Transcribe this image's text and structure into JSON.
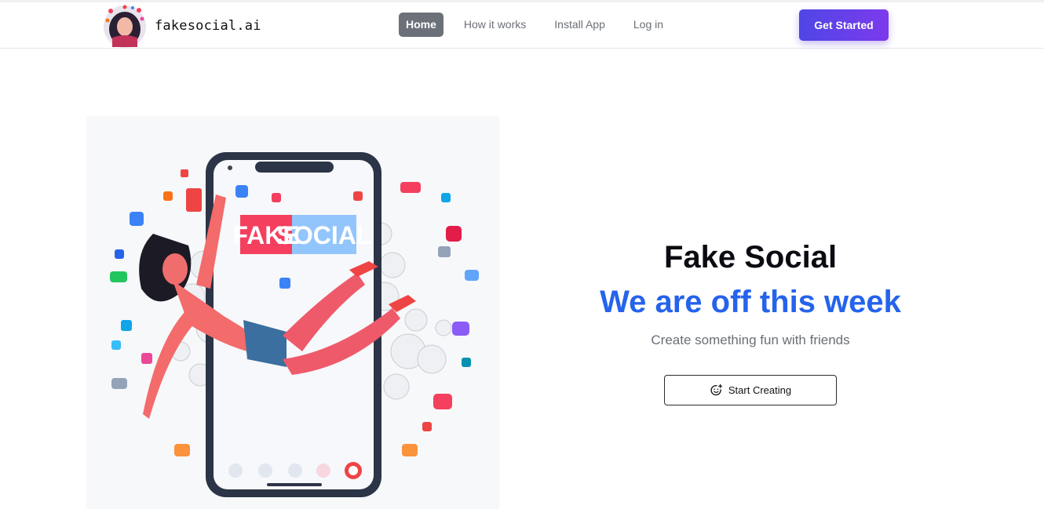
{
  "header": {
    "brand_name": "fakesocial.ai",
    "nav": [
      {
        "label": "Home",
        "active": true
      },
      {
        "label": "How it works",
        "active": false
      },
      {
        "label": "Install App",
        "active": false
      },
      {
        "label": "Log in",
        "active": false
      }
    ],
    "cta_label": "Get Started"
  },
  "hero": {
    "image_text": [
      "FAKE",
      "SOCIAL"
    ],
    "title": "Fake Social",
    "subtitle": "We are off this week",
    "description": "Create something fun with friends",
    "button_label": "Start Creating",
    "button_icon": "smiley-plus-icon"
  },
  "colors": {
    "accent_blue": "#2563eb",
    "cta_start": "#4f46e5",
    "cta_end": "#7c3aed",
    "nav_active_bg": "#6b7079"
  }
}
